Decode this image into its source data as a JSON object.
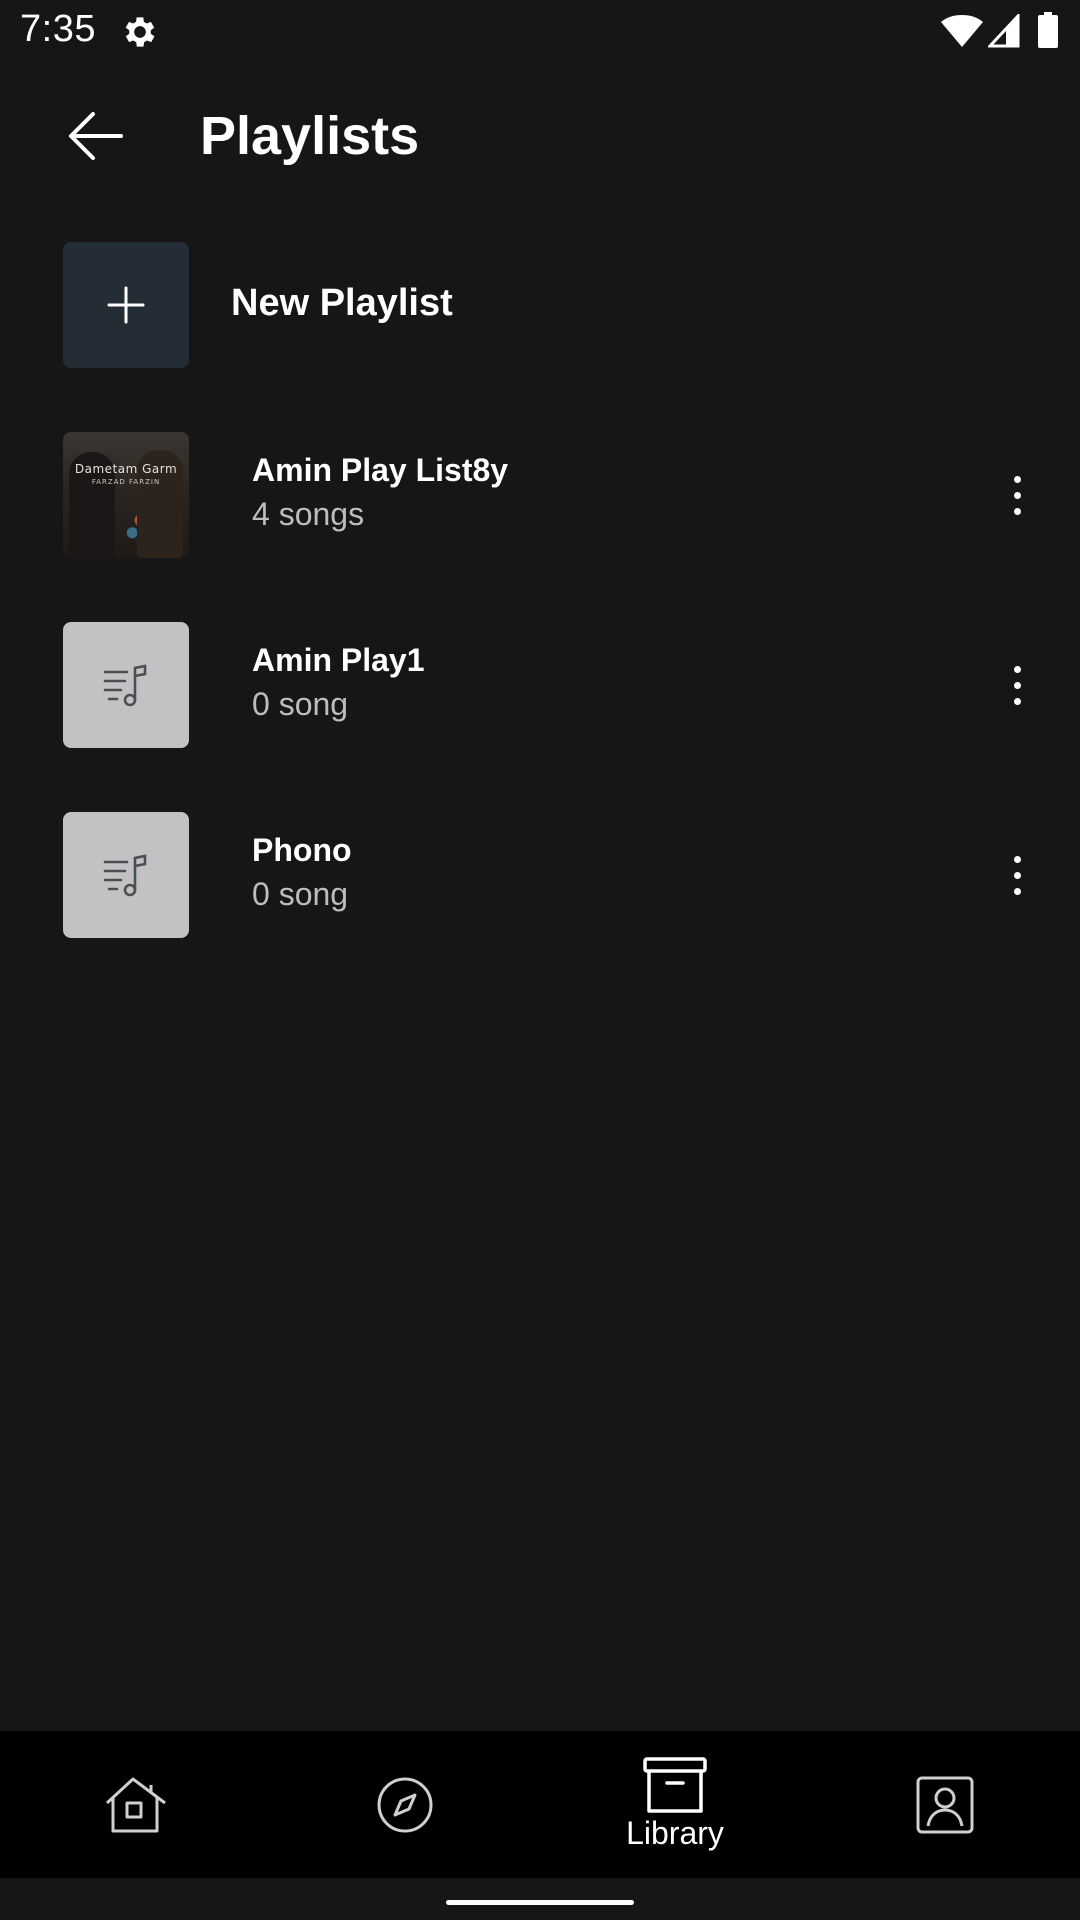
{
  "status_bar": {
    "time": "7:35",
    "icons": [
      "gear-icon",
      "wifi-icon",
      "signal-icon",
      "battery-icon"
    ]
  },
  "header": {
    "title": "Playlists",
    "back_icon": "arrow-left-icon"
  },
  "new_playlist": {
    "label": "New Playlist",
    "icon": "plus-icon",
    "thumb_color": "#242d35"
  },
  "playlists": [
    {
      "title": "Amin Play List8y",
      "subtitle": "4 songs",
      "art": "album-artwork",
      "art_text": "Dametam Garm",
      "art_subtext": "FARZAD FARZIN"
    },
    {
      "title": "Amin Play1",
      "subtitle": "0 song",
      "art": "playlist-music-icon"
    },
    {
      "title": "Phono",
      "subtitle": "0 song",
      "art": "playlist-music-icon"
    }
  ],
  "bottom_nav": {
    "items": [
      {
        "id": "home",
        "icon": "home-icon",
        "label": ""
      },
      {
        "id": "explore",
        "icon": "compass-icon",
        "label": ""
      },
      {
        "id": "library",
        "icon": "archive-box-icon",
        "label": "Library",
        "active": true
      },
      {
        "id": "profile",
        "icon": "profile-icon",
        "label": ""
      }
    ]
  },
  "colors": {
    "background": "#161617",
    "nav_background": "#000000",
    "text": "#ffffff",
    "subtext": "#bdbdbd",
    "default_thumb": "#c2c2c2"
  }
}
